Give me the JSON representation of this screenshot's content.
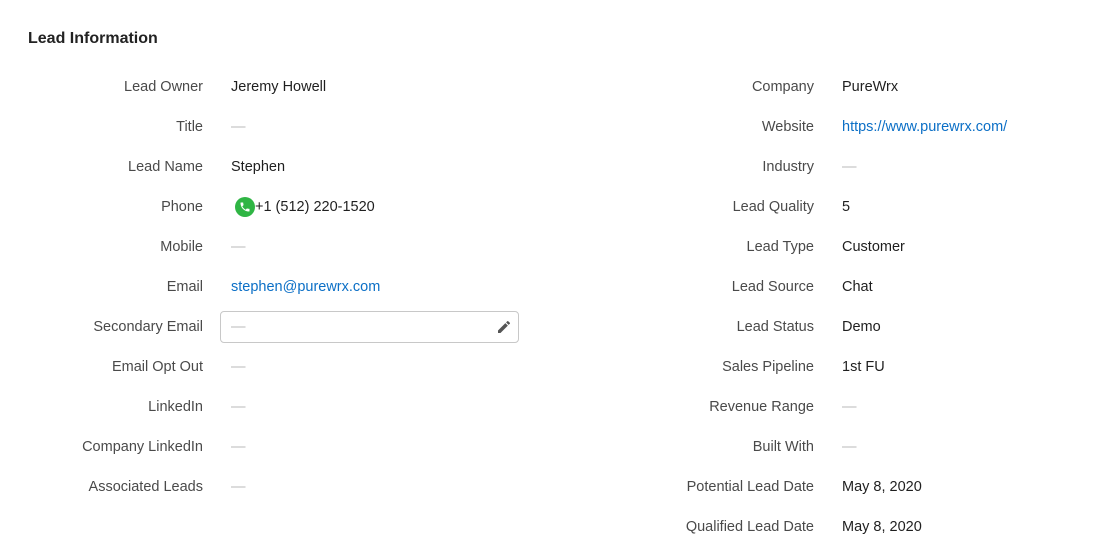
{
  "section": {
    "title": "Lead Information"
  },
  "left": [
    {
      "label": "Lead Owner",
      "value": "Jeremy Howell"
    },
    {
      "label": "Title",
      "value": "—"
    },
    {
      "label": "Lead Name",
      "value": "Stephen"
    },
    {
      "label": "Phone",
      "value": "+1 (512) 220-1520",
      "icon": "phone-icon",
      "icon_color": "#2fb544"
    },
    {
      "label": "Mobile",
      "value": "—"
    },
    {
      "label": "Email",
      "value": "stephen@purewrx.com"
    },
    {
      "label": "Secondary Email",
      "value": "—",
      "icon": "pencil-icon"
    },
    {
      "label": "Email Opt Out",
      "value": "—"
    },
    {
      "label": "LinkedIn",
      "value": "—"
    },
    {
      "label": "Company LinkedIn",
      "value": "—"
    },
    {
      "label": "Associated Leads",
      "value": "—"
    }
  ],
  "right": [
    {
      "label": "Company",
      "value": "PureWrx"
    },
    {
      "label": "Website",
      "value": "https://www.purewrx.com/"
    },
    {
      "label": "Industry",
      "value": "—"
    },
    {
      "label": "Lead Quality",
      "value": "5"
    },
    {
      "label": "Lead Type",
      "value": "Customer"
    },
    {
      "label": "Lead Source",
      "value": "Chat"
    },
    {
      "label": "Lead Status",
      "value": "Demo"
    },
    {
      "label": "Sales Pipeline",
      "value": "1st FU"
    },
    {
      "label": "Revenue Range",
      "value": "—"
    },
    {
      "label": "Built With",
      "value": "—"
    },
    {
      "label": "Potential Lead Date",
      "value": "May 8, 2020"
    },
    {
      "label": "Qualified Lead Date",
      "value": "May 8, 2020"
    }
  ],
  "colors": {
    "link": "#0b6fc6",
    "empty": "#b8b8b8",
    "label": "#4a4a4a"
  }
}
